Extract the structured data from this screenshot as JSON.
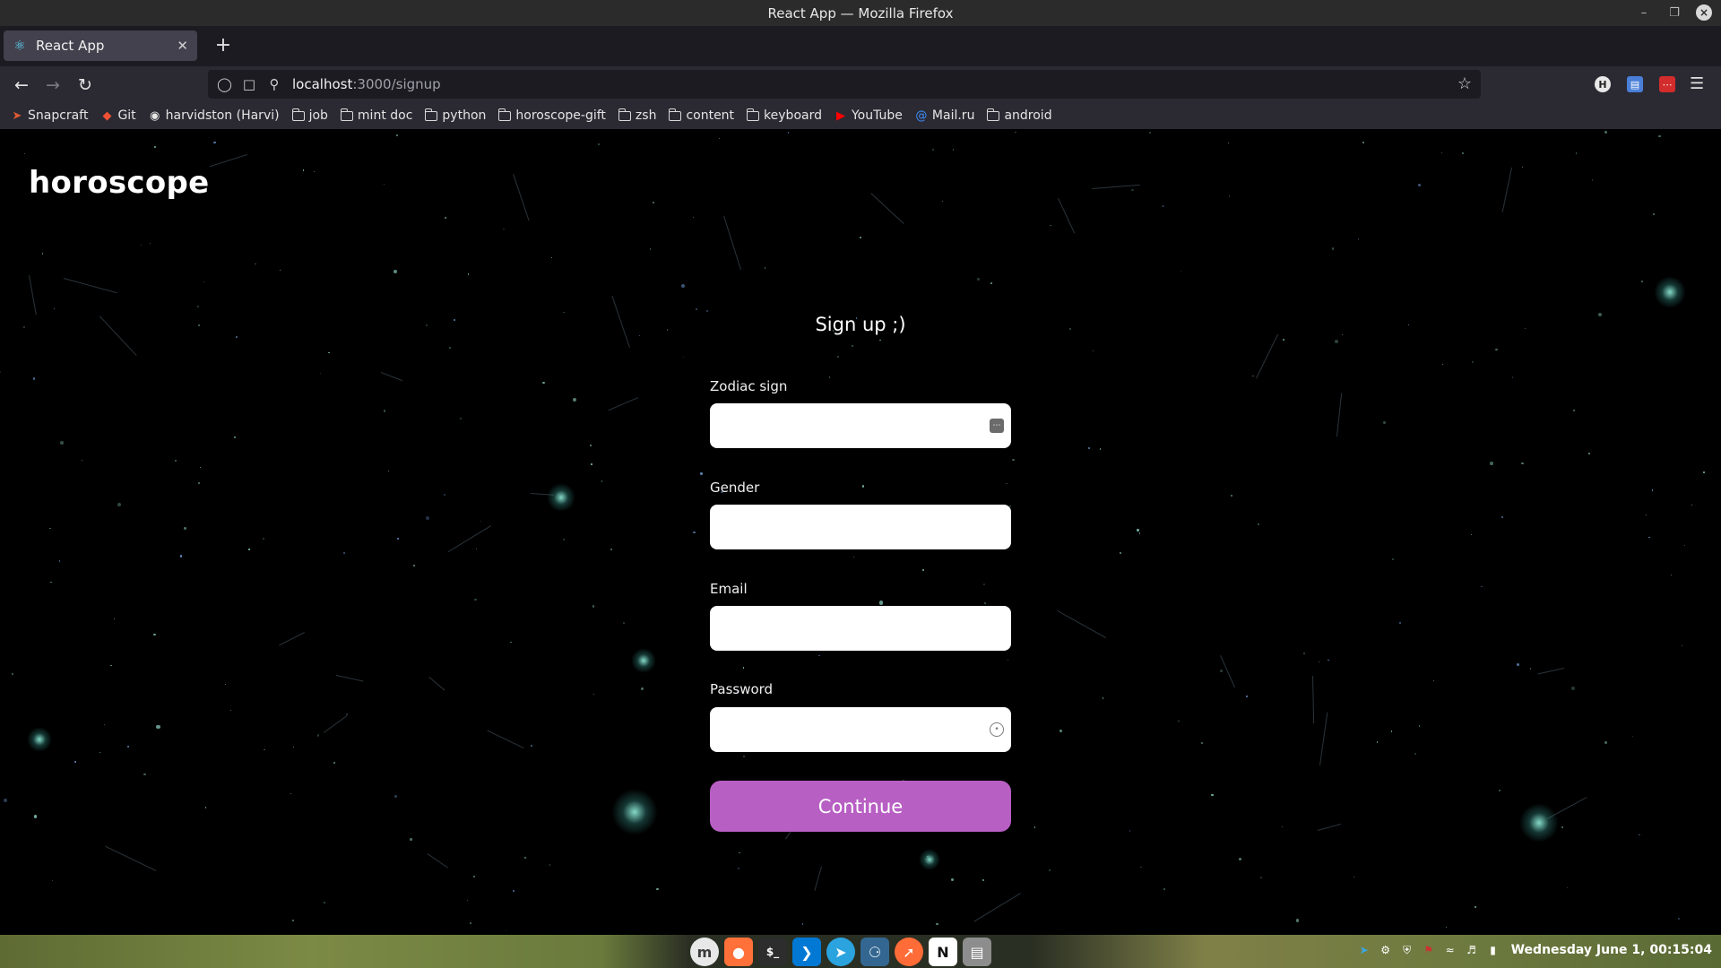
{
  "window": {
    "title": "React App — Mozilla Firefox"
  },
  "tabs": [
    {
      "label": "React App",
      "icon": "react-icon"
    }
  ],
  "navbar": {
    "url_host": "localhost",
    "url_path": ":3000/signup"
  },
  "bookmarks": [
    {
      "label": "Snapcraft",
      "icon": "snapcraft-icon"
    },
    {
      "label": "Git",
      "icon": "git-icon"
    },
    {
      "label": "harvidston (Harvi)",
      "icon": "github-icon"
    },
    {
      "label": "job",
      "icon": "folder-icon"
    },
    {
      "label": "mint doc",
      "icon": "folder-icon"
    },
    {
      "label": "python",
      "icon": "folder-icon"
    },
    {
      "label": "horoscope-gift",
      "icon": "folder-icon"
    },
    {
      "label": "zsh",
      "icon": "folder-icon"
    },
    {
      "label": "content",
      "icon": "folder-icon"
    },
    {
      "label": "keyboard",
      "icon": "folder-icon"
    },
    {
      "label": "YouTube",
      "icon": "youtube-icon"
    },
    {
      "label": "Mail.ru",
      "icon": "mailru-icon"
    },
    {
      "label": "android",
      "icon": "folder-icon"
    }
  ],
  "page": {
    "logo": "horoscope",
    "form_title": "Sign up ;)",
    "fields": {
      "zodiac": {
        "label": "Zodiac sign",
        "value": ""
      },
      "gender": {
        "label": "Gender",
        "value": ""
      },
      "email": {
        "label": "Email",
        "value": ""
      },
      "password": {
        "label": "Password",
        "value": ""
      }
    },
    "continue_label": "Continue",
    "colors": {
      "button": "#b85fc4",
      "background": "#000000"
    }
  },
  "taskbar": {
    "clock": "Wednesday June  1, 00:15:04",
    "apps": [
      "mint-menu-icon",
      "firefox-icon",
      "terminal-icon",
      "vscode-icon",
      "telegram-icon",
      "postgres-icon",
      "postman-icon",
      "notion-icon",
      "files-icon"
    ]
  }
}
